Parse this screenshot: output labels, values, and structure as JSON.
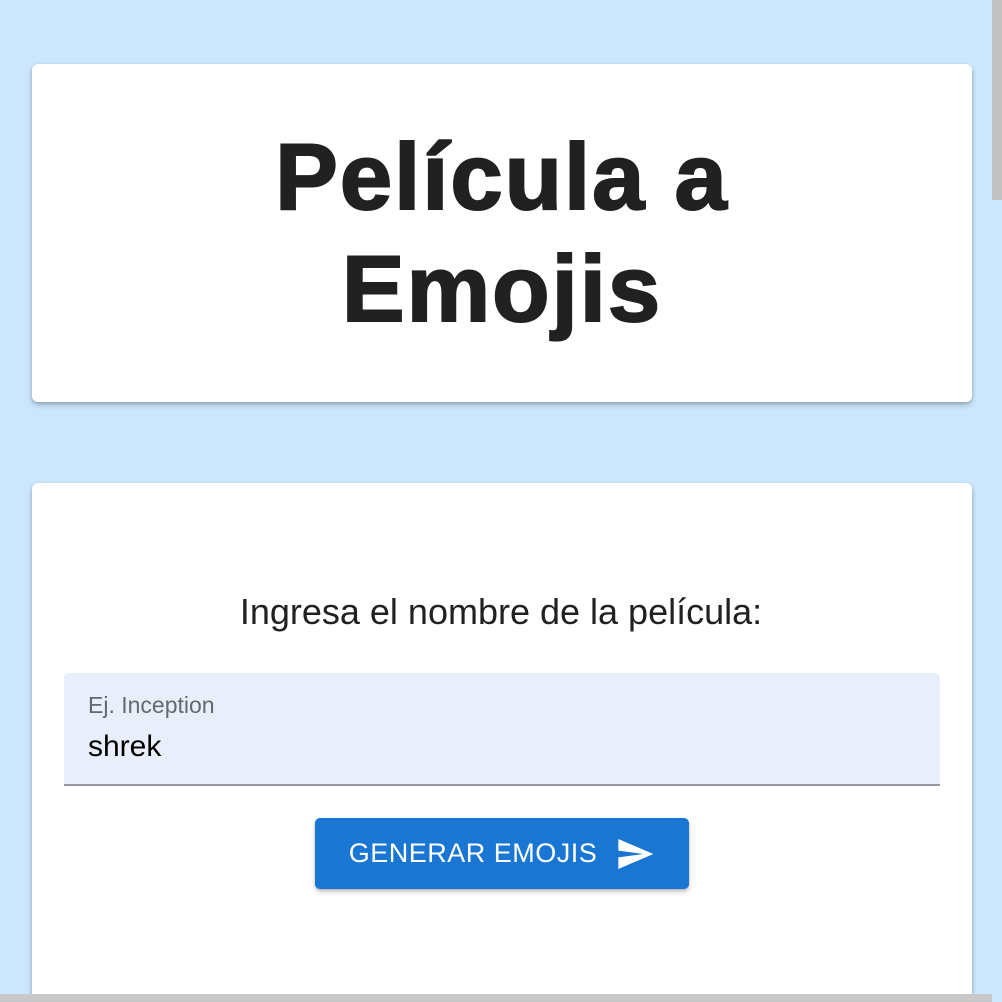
{
  "header": {
    "title": "Película a Emojis"
  },
  "form": {
    "prompt": "Ingresa el nombre de la película:",
    "input": {
      "label": "Ej. Inception",
      "value": "shrek"
    },
    "button": {
      "label": "GENERAR EMOJIS",
      "icon": "send-icon"
    }
  },
  "colors": {
    "background": "#cce7fd",
    "primary": "#1976d2",
    "field_background": "#e8effa"
  }
}
